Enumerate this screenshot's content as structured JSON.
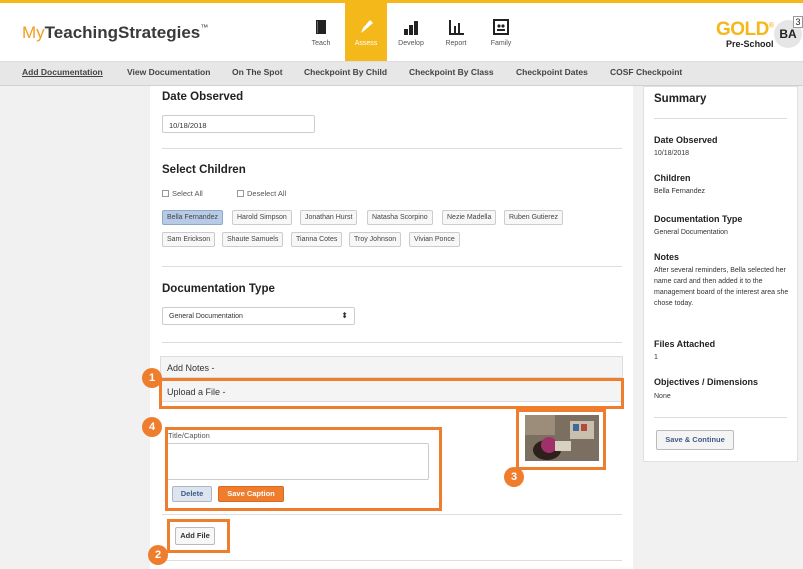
{
  "brand": {
    "my": "My",
    "rest": "TeachingStrategies",
    "tm": "™"
  },
  "nav": [
    {
      "label": "Teach",
      "icon": "book-icon",
      "active": false
    },
    {
      "label": "Assess",
      "icon": "pencil-icon",
      "active": true
    },
    {
      "label": "Develop",
      "icon": "bar-chart-icon",
      "active": false
    },
    {
      "label": "Report",
      "icon": "report-chart-icon",
      "active": false
    },
    {
      "label": "Family",
      "icon": "family-icon",
      "active": false
    }
  ],
  "product": {
    "name": "GOLD",
    "reg": "®",
    "level": "Pre-School"
  },
  "user": {
    "initials": "BA",
    "badge": "3"
  },
  "subnav": [
    "Add Documentation",
    "View Documentation",
    "On The Spot",
    "Checkpoint By Child",
    "Checkpoint By Class",
    "Checkpoint Dates",
    "COSF Checkpoint"
  ],
  "form": {
    "date_title": "Date Observed",
    "date_value": "10/18/2018",
    "children_title": "Select Children",
    "select_all": "Select All",
    "deselect_all": "Deselect All",
    "children": [
      {
        "name": "Bella Fernandez",
        "selected": true
      },
      {
        "name": "Harold Simpson",
        "selected": false
      },
      {
        "name": "Jonathan Hurst",
        "selected": false
      },
      {
        "name": "Natasha Scorpino",
        "selected": false
      },
      {
        "name": "Nezie Madella",
        "selected": false
      },
      {
        "name": "Ruben Gutierez",
        "selected": false
      },
      {
        "name": "Sam Erickson",
        "selected": false
      },
      {
        "name": "Shaute Samuels",
        "selected": false
      },
      {
        "name": "Tianna Cotes",
        "selected": false
      },
      {
        "name": "Troy Johnson",
        "selected": false
      },
      {
        "name": "Vivian Ponce",
        "selected": false
      }
    ],
    "doc_type_title": "Documentation Type",
    "doc_type_value": "General Documentation",
    "add_notes": "Add Notes  -",
    "upload_file": "Upload a File  -",
    "caption_label": "Title/Caption",
    "caption_value": "",
    "delete_label": "Delete",
    "save_caption_label": "Save Caption",
    "add_file_label": "Add File"
  },
  "markers": [
    "1",
    "2",
    "3",
    "4"
  ],
  "summary": {
    "title": "Summary",
    "date_head": "Date Observed",
    "date_val": "10/18/2018",
    "children_head": "Children",
    "children_val": "Bella Fernandez",
    "doc_type_head": "Documentation Type",
    "doc_type_val": "General Documentation",
    "notes_head": "Notes",
    "notes_val": "After several reminders, Bella selected her name card and then added it to the management board of the interest area she chose today.",
    "files_head": "Files Attached",
    "files_val": "1",
    "objectives_head": "Objectives / Dimensions",
    "objectives_val": "None",
    "continue_label": "Save & Continue"
  },
  "colors": {
    "accent": "#f5b81a",
    "highlight": "#ef7d2e",
    "selected_chip": "#b7cbe7"
  }
}
